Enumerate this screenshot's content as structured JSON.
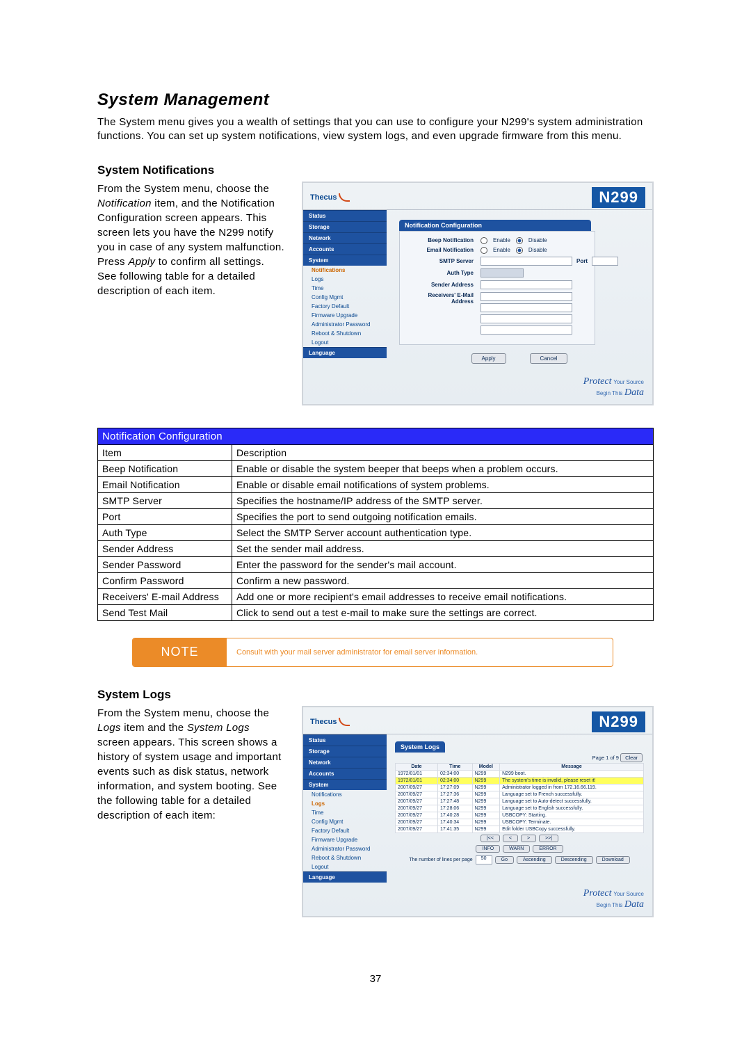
{
  "page_number": "37",
  "h1": "System Management",
  "intro": "The System menu gives you a wealth of settings that you can use to configure your N299's system administration functions. You can set up system notifications, view system logs, and even upgrade firmware from this menu.",
  "notif_head": "System Notifications",
  "notif_para_pre": "From the System menu, choose the ",
  "notif_para_em1": "Notification",
  "notif_para_mid1": " item, and the Notification Configuration screen appears. This screen lets you have the N299 notify you in case of any system malfunction. Press ",
  "notif_para_em2": "Apply",
  "notif_para_post": " to confirm all settings. See following table for a detailed description of each item.",
  "shot1": {
    "logo": "Thecus",
    "model": "N299",
    "nav_heads": [
      "Status",
      "Storage",
      "Network",
      "Accounts",
      "System",
      "Language"
    ],
    "system_items": [
      "Notifications",
      "Logs",
      "Time",
      "Config Mgmt",
      "Factory Default",
      "Firmware Upgrade",
      "Administrator Password",
      "Reboot & Shutdown",
      "Logout"
    ],
    "panel_title": "Notification Configuration",
    "rows": {
      "beep": "Beep Notification",
      "email": "Email Notification",
      "smtp": "SMTP Server",
      "port": "Port",
      "auth": "Auth Type",
      "sender": "Sender Address",
      "recv": "Receivers' E-Mail Address"
    },
    "enable": "Enable",
    "disable": "Disable",
    "apply": "Apply",
    "cancel": "Cancel",
    "footer_protect": "Protect",
    "footer_sub1": "Your Source",
    "footer_sub2": "Begin This",
    "footer_data": "Data"
  },
  "table_title": "Notification Configuration",
  "table_head_item": "Item",
  "table_head_desc": "Description",
  "table_rows": [
    {
      "item": "Beep Notification",
      "desc": "Enable or disable the system beeper that beeps when a problem occurs."
    },
    {
      "item": "Email Notification",
      "desc": "Enable or disable email notifications of system problems."
    },
    {
      "item": "SMTP Server",
      "desc": "Specifies the hostname/IP address of the SMTP server."
    },
    {
      "item": "Port",
      "desc": "Specifies the port to send outgoing notification emails."
    },
    {
      "item": "Auth Type",
      "desc": "Select the SMTP Server account authentication type."
    },
    {
      "item": "Sender Address",
      "desc": "Set the sender mail address."
    },
    {
      "item": "Sender Password",
      "desc": "Enter the password for the sender's mail account."
    },
    {
      "item": "Confirm Password",
      "desc": "Confirm a new password."
    },
    {
      "item": "Receivers' E-mail Address",
      "desc": "Add one or more recipient's email addresses to receive email notifications."
    },
    {
      "item": "Send Test Mail",
      "desc": "Click to send out a test e-mail to make sure the settings are correct."
    }
  ],
  "note_label": "NOTE",
  "note_text": "Consult with your mail server administrator for email server information.",
  "logs_head": "System Logs",
  "logs_para_pre": "From the System menu, choose the ",
  "logs_para_em1": "Logs",
  "logs_para_mid1": " item and the ",
  "logs_para_em2": "System Logs",
  "logs_para_post": " screen appears. This screen shows a history of system usage and important events such as disk status, network information, and system booting. See the following table for a detailed description of each item:",
  "shot2": {
    "panel_title": "System Logs",
    "page_info": "Page 1 of 9",
    "clear": "Clear",
    "cols": [
      "Date",
      "Time",
      "Model",
      "Message"
    ],
    "rows": [
      {
        "d": "1972/01/01",
        "t": "02:34:00",
        "m": "N299",
        "msg": "N299 boot.",
        "hl": false
      },
      {
        "d": "1972/01/01",
        "t": "02:34:00",
        "m": "N299",
        "msg": "The system's time is invalid, please reset it!",
        "hl": true
      },
      {
        "d": "2007/09/27",
        "t": "17:27:09",
        "m": "N299",
        "msg": "Administrator logged in from 172.16.66.119.",
        "hl": false
      },
      {
        "d": "2007/09/27",
        "t": "17:27:36",
        "m": "N299",
        "msg": "Language set to French successfully.",
        "hl": false
      },
      {
        "d": "2007/09/27",
        "t": "17:27:48",
        "m": "N299",
        "msg": "Language set to Auto-detect successfully.",
        "hl": false
      },
      {
        "d": "2007/09/27",
        "t": "17:28:06",
        "m": "N299",
        "msg": "Language set to English successfully.",
        "hl": false
      },
      {
        "d": "2007/09/27",
        "t": "17:40:28",
        "m": "N299",
        "msg": "USBCOPY: Starting.",
        "hl": false
      },
      {
        "d": "2007/09/27",
        "t": "17:40:34",
        "m": "N299",
        "msg": "USBCOPY: Terminate.",
        "hl": false
      },
      {
        "d": "2007/09/27",
        "t": "17:41:35",
        "m": "N299",
        "msg": "Edit folder USBCopy successfully.",
        "hl": false
      }
    ],
    "nav": {
      "first": "|<<",
      "prev": "<",
      "next": ">",
      "last": ">>|"
    },
    "filters": [
      "INFO",
      "WARN",
      "ERROR"
    ],
    "opts_label": "The number of lines per page",
    "opts_value": "50",
    "go": "Go",
    "asc": "Ascending",
    "desc": "Descending",
    "download": "Download"
  }
}
